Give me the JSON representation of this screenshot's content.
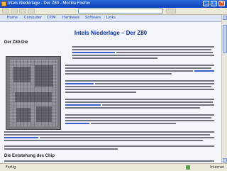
{
  "window": {
    "title": "Intels Niederlage - Der Z80 - Mozilla Firefox"
  },
  "nav": {
    "links": [
      "Home",
      "Computer",
      "CP/M",
      "Hardware",
      "Software",
      "Links"
    ]
  },
  "page": {
    "title": "Intels Niederlage – Der Z80",
    "die_caption": "Der Z80-Die",
    "bottom_heading": "Die Entstehung des Chip"
  },
  "status": {
    "text": "Fertig",
    "zone": "Internet"
  },
  "colors": {
    "titlebar": "#0a3fb8",
    "page_title": "#0c2e9a",
    "link": "#1d44b8"
  }
}
